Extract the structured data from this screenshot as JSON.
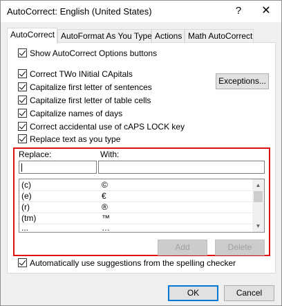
{
  "window": {
    "title": "AutoCorrect: English (United States)",
    "help_glyph": "?",
    "close_glyph": "✕"
  },
  "tabs": [
    {
      "label": "AutoCorrect",
      "active": true
    },
    {
      "label": "AutoFormat As You Type",
      "active": false
    },
    {
      "label": "Actions",
      "active": false
    },
    {
      "label": "Math AutoCorrect",
      "active": false
    }
  ],
  "options": {
    "show_buttons": "Show AutoCorrect Options buttons",
    "two_initial": "Correct TWo INitial CApitals",
    "first_sentence": "Capitalize first letter of sentences",
    "first_table": "Capitalize first letter of table cells",
    "names_days": "Capitalize names of days",
    "caps_lock": "Correct accidental use of cAPS LOCK key",
    "replace_text": "Replace text as you type",
    "spelling": "Automatically use suggestions from the spelling checker"
  },
  "buttons": {
    "exceptions": "Exceptions...",
    "add": "Add",
    "delete": "Delete",
    "ok": "OK",
    "cancel": "Cancel"
  },
  "replace": {
    "replace_label": "Replace:",
    "with_label": "With:",
    "replace_value": "",
    "with_value": ""
  },
  "entries": [
    {
      "replace": "(c)",
      "with": "©"
    },
    {
      "replace": "(e)",
      "with": "€"
    },
    {
      "replace": "(r)",
      "with": "®"
    },
    {
      "replace": "(tm)",
      "with": "™"
    },
    {
      "replace": "...",
      "with": "…"
    }
  ],
  "colors": {
    "highlight": "#e01010",
    "default_button_border": "#0078d7"
  }
}
